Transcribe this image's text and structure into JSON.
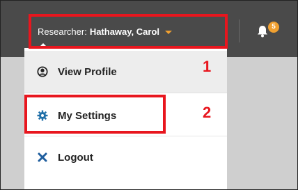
{
  "header": {
    "user_prefix": "Researcher:",
    "user_name": "Hathaway, Carol",
    "notification_count": "5"
  },
  "menu": {
    "items": [
      {
        "label": "View Profile",
        "icon": "user-circle-icon"
      },
      {
        "label": "My Settings",
        "icon": "gear-icon"
      },
      {
        "label": "Logout",
        "icon": "close-icon"
      }
    ]
  },
  "annotations": {
    "step1": "1",
    "step2": "2"
  },
  "colors": {
    "topbar": "#4a4a4a",
    "accent": "#f0a030",
    "highlight": "#e8161e",
    "settings_icon": "#1f6fa8",
    "logout_icon": "#1f5e9e"
  }
}
